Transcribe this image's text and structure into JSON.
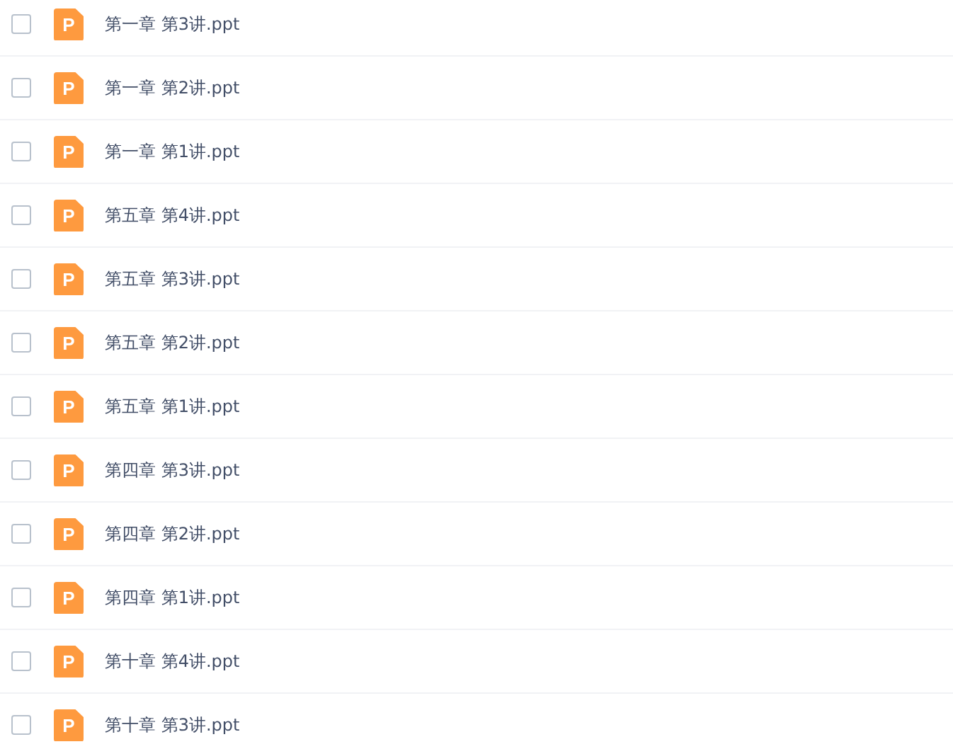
{
  "files": [
    {
      "name": "第一章 第3讲.ppt",
      "icon_letter": "P",
      "checked": false
    },
    {
      "name": "第一章 第2讲.ppt",
      "icon_letter": "P",
      "checked": false
    },
    {
      "name": "第一章 第1讲.ppt",
      "icon_letter": "P",
      "checked": false
    },
    {
      "name": "第五章 第4讲.ppt",
      "icon_letter": "P",
      "checked": false
    },
    {
      "name": "第五章 第3讲.ppt",
      "icon_letter": "P",
      "checked": false
    },
    {
      "name": "第五章 第2讲.ppt",
      "icon_letter": "P",
      "checked": false
    },
    {
      "name": "第五章 第1讲.ppt",
      "icon_letter": "P",
      "checked": false
    },
    {
      "name": "第四章 第3讲.ppt",
      "icon_letter": "P",
      "checked": false
    },
    {
      "name": "第四章 第2讲.ppt",
      "icon_letter": "P",
      "checked": false
    },
    {
      "name": "第四章 第1讲.ppt",
      "icon_letter": "P",
      "checked": false
    },
    {
      "name": "第十章 第4讲.ppt",
      "icon_letter": "P",
      "checked": false
    },
    {
      "name": "第十章 第3讲.ppt",
      "icon_letter": "P",
      "checked": false
    }
  ]
}
